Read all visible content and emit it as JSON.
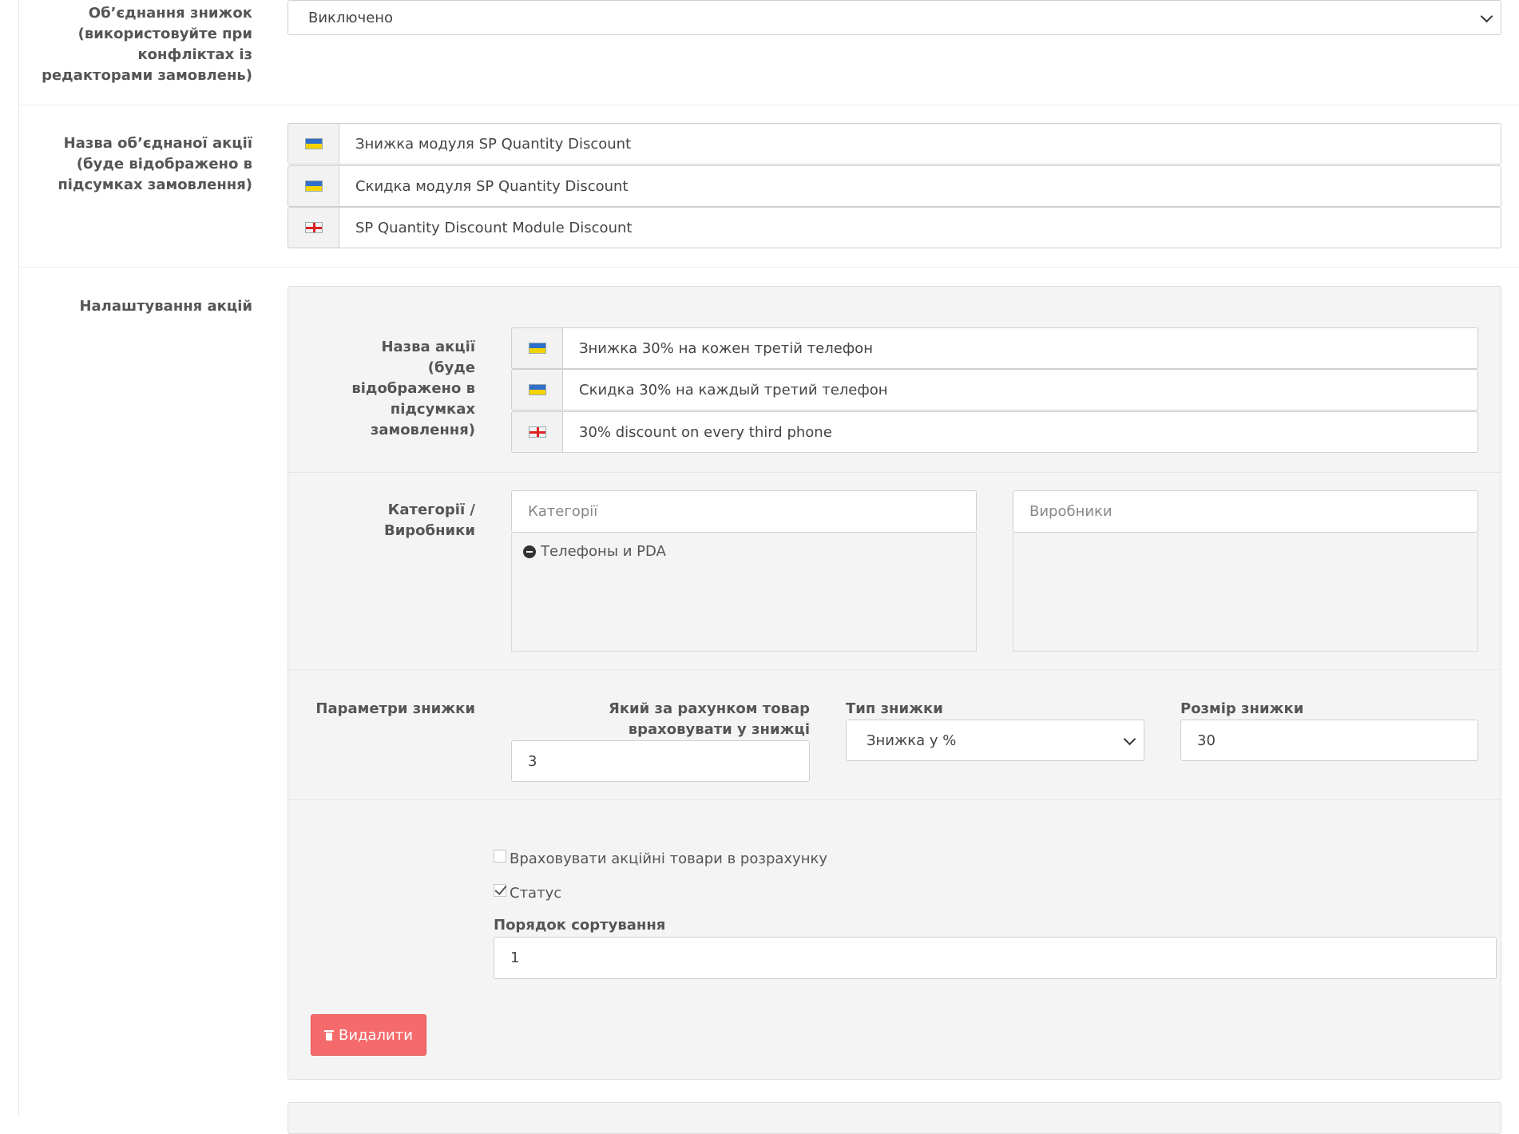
{
  "merge": {
    "label": "Об’єднання знижок (використовуйте при конфліктах із редакторами замовлень)",
    "value": "Виключено"
  },
  "merged_name": {
    "label": "Назва об’єднаної акції (буде відображено в підсумках замовлення)",
    "items": [
      {
        "flag": "ua-flag-icon",
        "value": "Знижка модуля SP Quantity Discount"
      },
      {
        "flag": "ua-flag-icon",
        "value": "Скидка модуля SP Quantity Discount"
      },
      {
        "flag": "en-flag-icon",
        "value": "SP Quantity Discount Module Discount"
      }
    ]
  },
  "settings": {
    "label": "Налаштування акцій",
    "promo_name": {
      "label": "Назва акції (буде відображено в підсумках замовлення)",
      "items": [
        {
          "flag": "ua-flag-icon",
          "value": "Знижка 30% на кожен третій телефон"
        },
        {
          "flag": "ua-flag-icon",
          "value": "Скидка 30% на каждый третий телефон"
        },
        {
          "flag": "en-flag-icon",
          "value": "30% discount on every third phone"
        }
      ]
    },
    "categories": {
      "label": "Категорії / Виробники",
      "categories_placeholder": "Категорії",
      "manufacturers_placeholder": "Виробники",
      "selected_categories": [
        "Телефоны и PDA"
      ]
    },
    "params": {
      "label": "Параметри знижки",
      "item_number_label": "Який за рахунком товар враховувати у знижці",
      "item_number_value": "3",
      "type_label": "Тип знижки",
      "type_value": "Знижка у %",
      "size_label": "Розмір знижки",
      "size_value": "30"
    },
    "include_promo": {
      "label": "Враховувати акційні товари в розрахунку",
      "checked": false
    },
    "status": {
      "label": "Статус",
      "checked": true
    },
    "sort_order": {
      "label": "Порядок сортування",
      "value": "1"
    },
    "delete_label": "Видалити",
    "colors": {
      "danger": "#f56b6b",
      "panel_bg": "#f4f4f4"
    }
  }
}
